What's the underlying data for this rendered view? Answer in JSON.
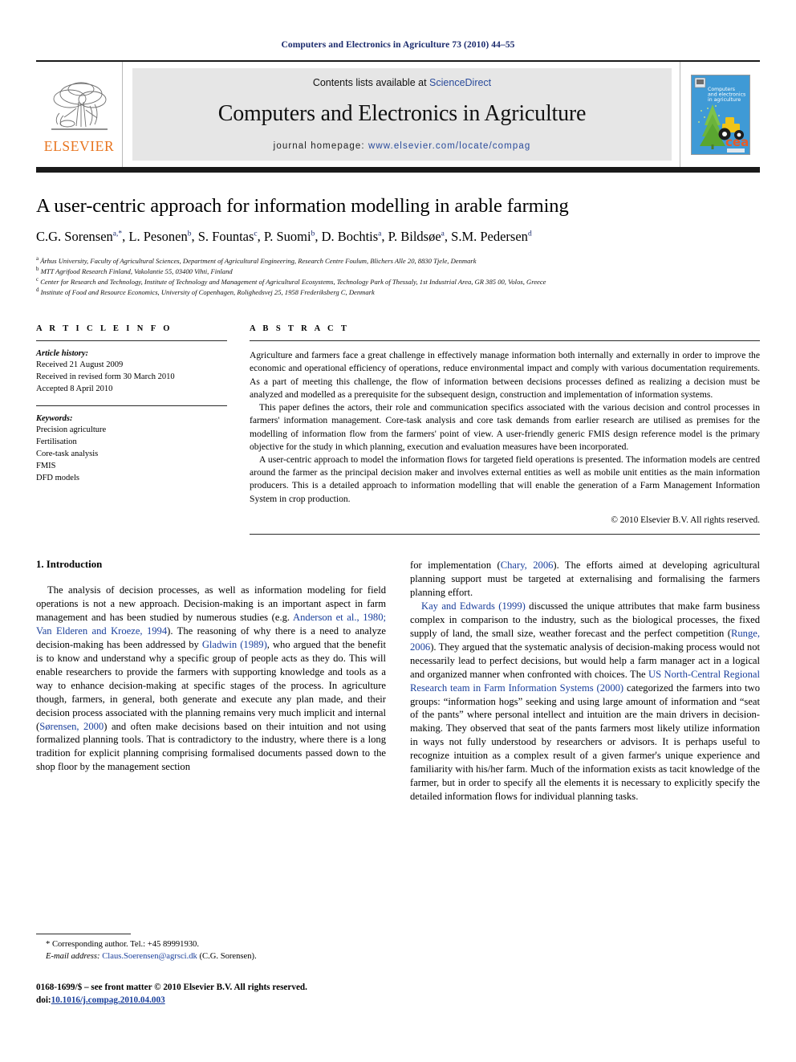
{
  "running_head": "Computers and Electronics in Agriculture 73 (2010) 44–55",
  "masthead": {
    "publisher_logo_text": "ELSEVIER",
    "contents_prefix": "Contents lists available at",
    "contents_link": "ScienceDirect",
    "journal_title": "Computers and Electronics in Agriculture",
    "homepage_prefix": "journal homepage:",
    "homepage_url": "www.elsevier.com/locate/compag",
    "cover_title_lines": [
      "Computers",
      "and electronics",
      "in agriculture"
    ],
    "cover_logo_text": "cea"
  },
  "article": {
    "title": "A user-centric approach for information modelling in arable farming",
    "authors_html": "C.G. Sorensen<sup>a,*</sup>, L. Pesonen<sup>b</sup>, S. Fountas<sup>c</sup>, P. Suomi<sup>b</sup>, D. Bochtis<sup>a</sup>, P. Bildsøe<sup>a</sup>, S.M. Pedersen<sup>d</sup>",
    "affiliations": [
      {
        "marker": "a",
        "text": "Århus University, Faculty of Agricultural Sciences, Department of Agricultural Engineering, Research Centre Foulum, Blichers Alle 20, 8830 Tjele, Denmark"
      },
      {
        "marker": "b",
        "text": "MTT Agrifood Research Finland, Vakolantie 55, 03400 Vihti, Finland"
      },
      {
        "marker": "c",
        "text": "Center for Research and Technology, Institute of Technology and Management of Agricultural Ecosystems, Technology Park of Thessaly, 1st Industrial Area, GR 385 00, Volos, Greece"
      },
      {
        "marker": "d",
        "text": "Institute of Food and Resource Economics, University of Copenhagen, Rolighedsvej 25, 1958 Frederiksberg C, Denmark"
      }
    ]
  },
  "article_info": {
    "heading": "A R T I C L E   I N F O",
    "history_label": "Article history:",
    "history_lines": [
      "Received 21 August 2009",
      "Received in revised form 30 March 2010",
      "Accepted 8 April 2010"
    ],
    "keywords_label": "Keywords:",
    "keywords": [
      "Precision agriculture",
      "Fertilisation",
      "Core-task analysis",
      "FMIS",
      "DFD models"
    ]
  },
  "abstract": {
    "heading": "A B S T R A C T",
    "paragraphs": [
      "Agriculture and farmers face a great challenge in effectively manage information both internally and externally in order to improve the economic and operational efficiency of operations, reduce environmental impact and comply with various documentation requirements. As a part of meeting this challenge, the flow of information between decisions processes defined as realizing a decision must be analyzed and modelled as a prerequisite for the subsequent design, construction and implementation of information systems.",
      "This paper defines the actors, their role and communication specifics associated with the various decision and control processes in farmers' information management. Core-task analysis and core task demands from earlier research are utilised as premises for the modelling of information flow from the farmers' point of view. A user-friendly generic FMIS design reference model is the primary objective for the study in which planning, execution and evaluation measures have been incorporated.",
      "A user-centric approach to model the information flows for targeted field operations is presented. The information models are centred around the farmer as the principal decision maker and involves external entities as well as mobile unit entities as the main information producers. This is a detailed approach to information modelling that will enable the generation of a Farm Management Information System in crop production."
    ],
    "copyright": "© 2010 Elsevier B.V. All rights reserved."
  },
  "body": {
    "section_heading": "1. Introduction",
    "left_paragraph_html": "The analysis of decision processes, as well as information modeling for field operations is not a new approach. Decision-making is an important aspect in farm management and has been studied by numerous studies (e.g. <a class=\"ref\" href=\"#\">Anderson et al., 1980; Van Elderen and Kroeze, 1994</a>). The reasoning of why there is a need to analyze decision-making has been addressed by <a class=\"ref\" href=\"#\">Gladwin (1989)</a>, who argued that the benefit is to know and understand why a specific group of people acts as they do. This will enable researchers to provide the farmers with supporting knowledge and tools as a way to enhance decision-making at specific stages of the process. In agriculture though, farmers, in general, both generate and execute any plan made, and their decision process associated with the planning remains very much implicit and internal (<a class=\"ref\" href=\"#\">Sørensen, 2000</a>) and often make decisions based on their intuition and not using formalized planning tools. That is contradictory to the industry, where there is a long tradition for explicit planning comprising formalised documents passed down to the shop floor by the management section",
    "right_paragraph_1_html": "for implementation (<a class=\"ref\" href=\"#\">Chary, 2006</a>). The efforts aimed at developing agricultural planning support must be targeted at externalising and formalising the farmers planning effort.",
    "right_paragraph_2_html": "<a class=\"ref\" href=\"#\">Kay and Edwards (1999)</a> discussed the unique attributes that make farm business complex in comparison to the industry, such as the biological processes, the fixed supply of land, the small size, weather forecast and the perfect competition (<a class=\"ref\" href=\"#\">Runge, 2006</a>). They argued that the systematic analysis of decision-making process would not necessarily lead to perfect decisions, but would help a farm manager act in a logical and organized manner when confronted with choices. The <a class=\"ref\" href=\"#\">US North-Central Regional Research team in Farm Information Systems (2000)</a> categorized the farmers into two groups: &ldquo;information hogs&rdquo; seeking and using large amount of information and &ldquo;seat of the pants&rdquo; where personal intellect and intuition are the main drivers in decision-making. They observed that seat of the pants farmers most likely utilize information in ways not fully understood by researchers or advisors. It is perhaps useful to recognize intuition as a complex result of a given farmer's unique experience and familiarity with his/her farm. Much of the information exists as tacit knowledge of the farmer, but in order to specify all the elements it is necessary to explicitly specify the detailed information flows for individual planning tasks."
  },
  "footnotes": {
    "corresponding_author": "* Corresponding author. Tel.: +45 89991930.",
    "email_label": "E-mail address:",
    "email_address": "Claus.Soerensen@agrsci.dk",
    "email_suffix": "(C.G. Sorensen).",
    "issn_line": "0168-1699/$ – see front matter © 2010 Elsevier B.V. All rights reserved.",
    "doi_prefix": "doi:",
    "doi_value": "10.1016/j.compag.2010.04.003"
  },
  "colors": {
    "link_blue": "#1a3f9b",
    "running_head_blue": "#1a2a6c",
    "elsevier_orange": "#E8741E",
    "banner_gray": "#e6e6e6",
    "cover_blue": "#3f9ad6"
  }
}
